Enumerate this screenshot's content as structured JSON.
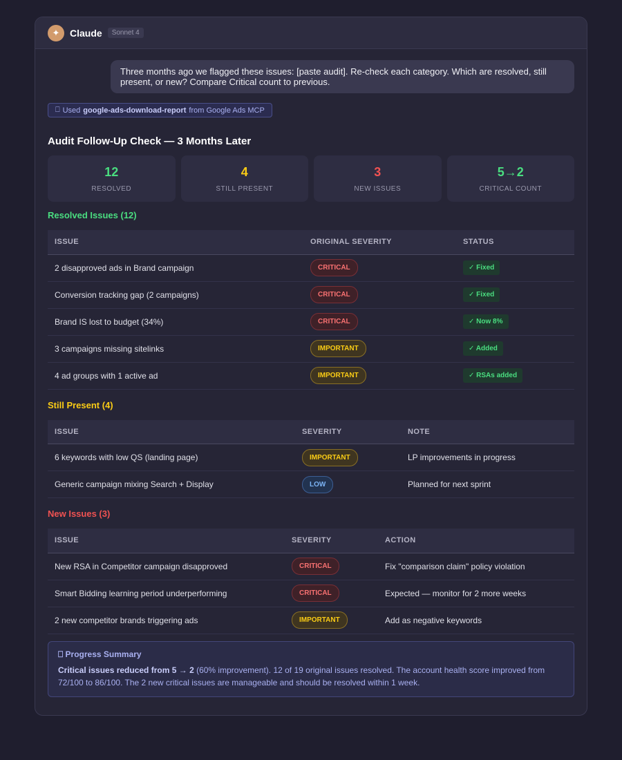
{
  "app": {
    "title": "Claude",
    "model": "Sonnet 4",
    "logo_glyph": "✦"
  },
  "user_message": "Three months ago we flagged these issues: [paste audit]. Re-check each category. Which are resolved, still present, or new? Compare Critical count to previous.",
  "tool_use": {
    "icon": "⎕",
    "prefix": "Used",
    "tool_name": "google-ads-download-report",
    "suffix": "from Google Ads MCP"
  },
  "report_title": "Audit Follow-Up Check — 3 Months Later",
  "stats": [
    {
      "value": "12",
      "label": "RESOLVED",
      "color": "#4ade80"
    },
    {
      "value": "4",
      "label": "STILL PRESENT",
      "color": "#facc15"
    },
    {
      "value": "3",
      "label": "NEW ISSUES",
      "color": "#f05252"
    },
    {
      "value": "5→2",
      "label": "CRITICAL COUNT",
      "color": "#4ade80"
    }
  ],
  "resolved": {
    "title": "Resolved Issues (12)",
    "columns": [
      "ISSUE",
      "ORIGINAL SEVERITY",
      "STATUS"
    ],
    "rows": [
      {
        "issue": "2 disapproved ads in Brand campaign",
        "severity": "CRITICAL",
        "status": "✓ Fixed"
      },
      {
        "issue": "Conversion tracking gap (2 campaigns)",
        "severity": "CRITICAL",
        "status": "✓ Fixed"
      },
      {
        "issue": "Brand IS lost to budget (34%)",
        "severity": "CRITICAL",
        "status": "✓ Now 8%"
      },
      {
        "issue": "3 campaigns missing sitelinks",
        "severity": "IMPORTANT",
        "status": "✓ Added"
      },
      {
        "issue": "4 ad groups with 1 active ad",
        "severity": "IMPORTANT",
        "status": "✓ RSAs added"
      }
    ]
  },
  "still_present": {
    "title": "Still Present (4)",
    "columns": [
      "ISSUE",
      "SEVERITY",
      "NOTE"
    ],
    "rows": [
      {
        "issue": "6 keywords with low QS (landing page)",
        "severity": "IMPORTANT",
        "note": "LP improvements in progress"
      },
      {
        "issue": "Generic campaign mixing Search + Display",
        "severity": "LOW",
        "note": "Planned for next sprint"
      }
    ]
  },
  "new_issues": {
    "title": "New Issues (3)",
    "columns": [
      "ISSUE",
      "SEVERITY",
      "ACTION"
    ],
    "rows": [
      {
        "issue": "New RSA in Competitor campaign disapproved",
        "severity": "CRITICAL",
        "action": "Fix \"comparison claim\" policy violation"
      },
      {
        "issue": "Smart Bidding learning period underperforming",
        "severity": "CRITICAL",
        "action": "Expected — monitor for 2 more weeks"
      },
      {
        "issue": "2 new competitor brands triggering ads",
        "severity": "IMPORTANT",
        "action": "Add as negative keywords"
      }
    ]
  },
  "summary": {
    "icon": "⎕",
    "title": "Progress Summary",
    "bold": "Critical issues reduced from 5 → 2",
    "body": " (60% improvement). 12 of 19 original issues resolved. The account health score improved from 72/100 to 86/100. The 2 new critical issues are manageable and should be resolved within 1 week."
  },
  "colors": {
    "resolved": "#4ade80",
    "still_present": "#facc15",
    "new_issues": "#f05252",
    "critical": "#f87171",
    "important": "#facc15",
    "low": "#7cb4f5"
  }
}
